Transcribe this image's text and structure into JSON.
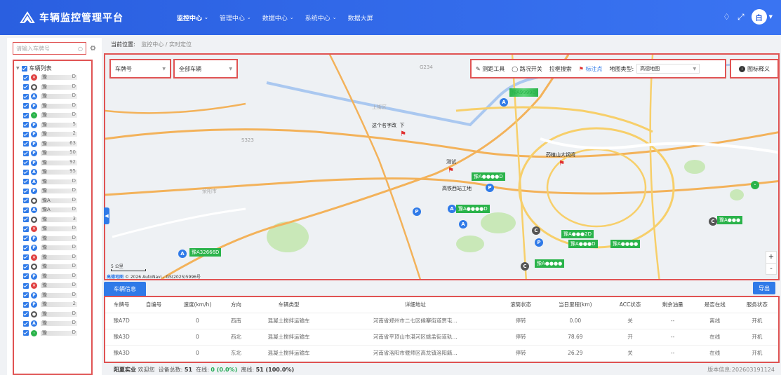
{
  "app": {
    "title": "车辆监控管理平台"
  },
  "nav": [
    {
      "label": "监控中心",
      "active": true
    },
    {
      "label": "管理中心"
    },
    {
      "label": "数据中心"
    },
    {
      "label": "系统中心"
    },
    {
      "label": "数据大屏"
    }
  ],
  "header_right": {
    "avatar_text": "白"
  },
  "sidebar": {
    "search_placeholder": "请输入车牌号",
    "tree_root": "车辆列表",
    "items": [
      {
        "icon": "red-x",
        "prefix": "豫",
        "suffix": "D"
      },
      {
        "icon": "gray",
        "prefix": "豫",
        "suffix": "D"
      },
      {
        "icon": "blue-a",
        "prefix": "豫",
        "suffix": "D"
      },
      {
        "icon": "blue-p",
        "prefix": "豫",
        "suffix": "D"
      },
      {
        "icon": "green",
        "prefix": "豫",
        "suffix": "D"
      },
      {
        "icon": "blue-p",
        "prefix": "豫",
        "suffix": "5"
      },
      {
        "icon": "blue-p",
        "prefix": "豫",
        "suffix": "2"
      },
      {
        "icon": "blue-p",
        "prefix": "豫",
        "suffix": "63"
      },
      {
        "icon": "blue-p",
        "prefix": "豫",
        "suffix": "50"
      },
      {
        "icon": "blue-p",
        "prefix": "豫",
        "suffix": "92"
      },
      {
        "icon": "blue-a",
        "prefix": "豫",
        "suffix": "95"
      },
      {
        "icon": "blue-a",
        "prefix": "豫",
        "suffix": "D"
      },
      {
        "icon": "blue-p",
        "prefix": "豫",
        "suffix": "D"
      },
      {
        "icon": "gray",
        "prefix": "豫A",
        "suffix": "D"
      },
      {
        "icon": "blue-a",
        "prefix": "豫A",
        "suffix": "D"
      },
      {
        "icon": "gray",
        "prefix": "豫",
        "suffix": "3"
      },
      {
        "icon": "red-x",
        "prefix": "豫",
        "suffix": "D"
      },
      {
        "icon": "blue-p",
        "prefix": "豫",
        "suffix": "D"
      },
      {
        "icon": "blue-p",
        "prefix": "豫",
        "suffix": "D"
      },
      {
        "icon": "red-x",
        "prefix": "豫",
        "suffix": "D"
      },
      {
        "icon": "gray",
        "prefix": "豫",
        "suffix": "D"
      },
      {
        "icon": "blue-p",
        "prefix": "豫",
        "suffix": "D"
      },
      {
        "icon": "red-x",
        "prefix": "豫",
        "suffix": "D"
      },
      {
        "icon": "blue-p",
        "prefix": "豫",
        "suffix": "D"
      },
      {
        "icon": "blue-p",
        "prefix": "豫",
        "suffix": "2"
      },
      {
        "icon": "gray",
        "prefix": "豫",
        "suffix": "D"
      },
      {
        "icon": "blue-a",
        "prefix": "豫",
        "suffix": "D"
      },
      {
        "icon": "green",
        "prefix": "豫",
        "suffix": "D"
      }
    ]
  },
  "breadcrumb": {
    "label": "当前位置:",
    "path": "监控中心 / 实时定位"
  },
  "map_controls": {
    "plate_select": "车牌号",
    "vehicle_select": "全部车辆",
    "tools": [
      "测距工具",
      "路况开关",
      "拉框搜索",
      "标注点"
    ],
    "map_type_label": "地图类型:",
    "map_type_value": "高德地图",
    "legend_button": "图标释义",
    "zoom_in": "+",
    "zoom_out": "-",
    "scale_label": "5 公里",
    "attribution_brand": "高德地图",
    "attribution_text": "© 2026 AutoNavi - GS(2025)5996号"
  },
  "map_labels": {
    "place1": "这个名字改",
    "place1b": "下",
    "place2": "测试",
    "place3": "高铁西站工地",
    "place4": "药植山大钢湾",
    "marker_plate": "豫A32666D"
  },
  "vehicle_panel": {
    "tab": "车辆信息",
    "export": "导出",
    "columns": [
      "车牌号",
      "自编号",
      "速度(km/h)",
      "方向",
      "车辆类型",
      "详细地址",
      "滚筒状态",
      "当日里程(km)",
      "ACC状态",
      "剩余油量",
      "是否在线",
      "服务状态"
    ],
    "rows": [
      [
        "豫A7D",
        "",
        "0",
        "西南",
        "混凝土搅拌运输车",
        "河南省郑州市二七区候寨街道贾屯…",
        "停转",
        "0.00",
        "关",
        "--",
        "离线",
        "开机"
      ],
      [
        "豫A3D",
        "",
        "0",
        "西北",
        "混凝土搅拌运输车",
        "河南省平顶山市湛河区姚孟街道轨…",
        "停转",
        "78.69",
        "开",
        "--",
        "在线",
        "开机"
      ],
      [
        "豫A3D",
        "",
        "0",
        "东北",
        "混凝土搅拌运输车",
        "河南省洛阳市偃师区高龙镇洛阳籍…",
        "停转",
        "26.29",
        "关",
        "--",
        "在线",
        "开机"
      ]
    ]
  },
  "footer": {
    "company": "阳夏实业",
    "welcome": "欢迎您",
    "total_label": "设备总数:",
    "total": "51",
    "online_label": "在线:",
    "online": "0 (0.0%)",
    "offline_label": "离线:",
    "offline": "51 (100.0%)",
    "version": "版本信息:202603191124"
  },
  "colors": {
    "accent": "#2f7ae8",
    "header": "#2a5fe0",
    "annotation": "#e05353",
    "marker_green": "#2ab34a"
  }
}
